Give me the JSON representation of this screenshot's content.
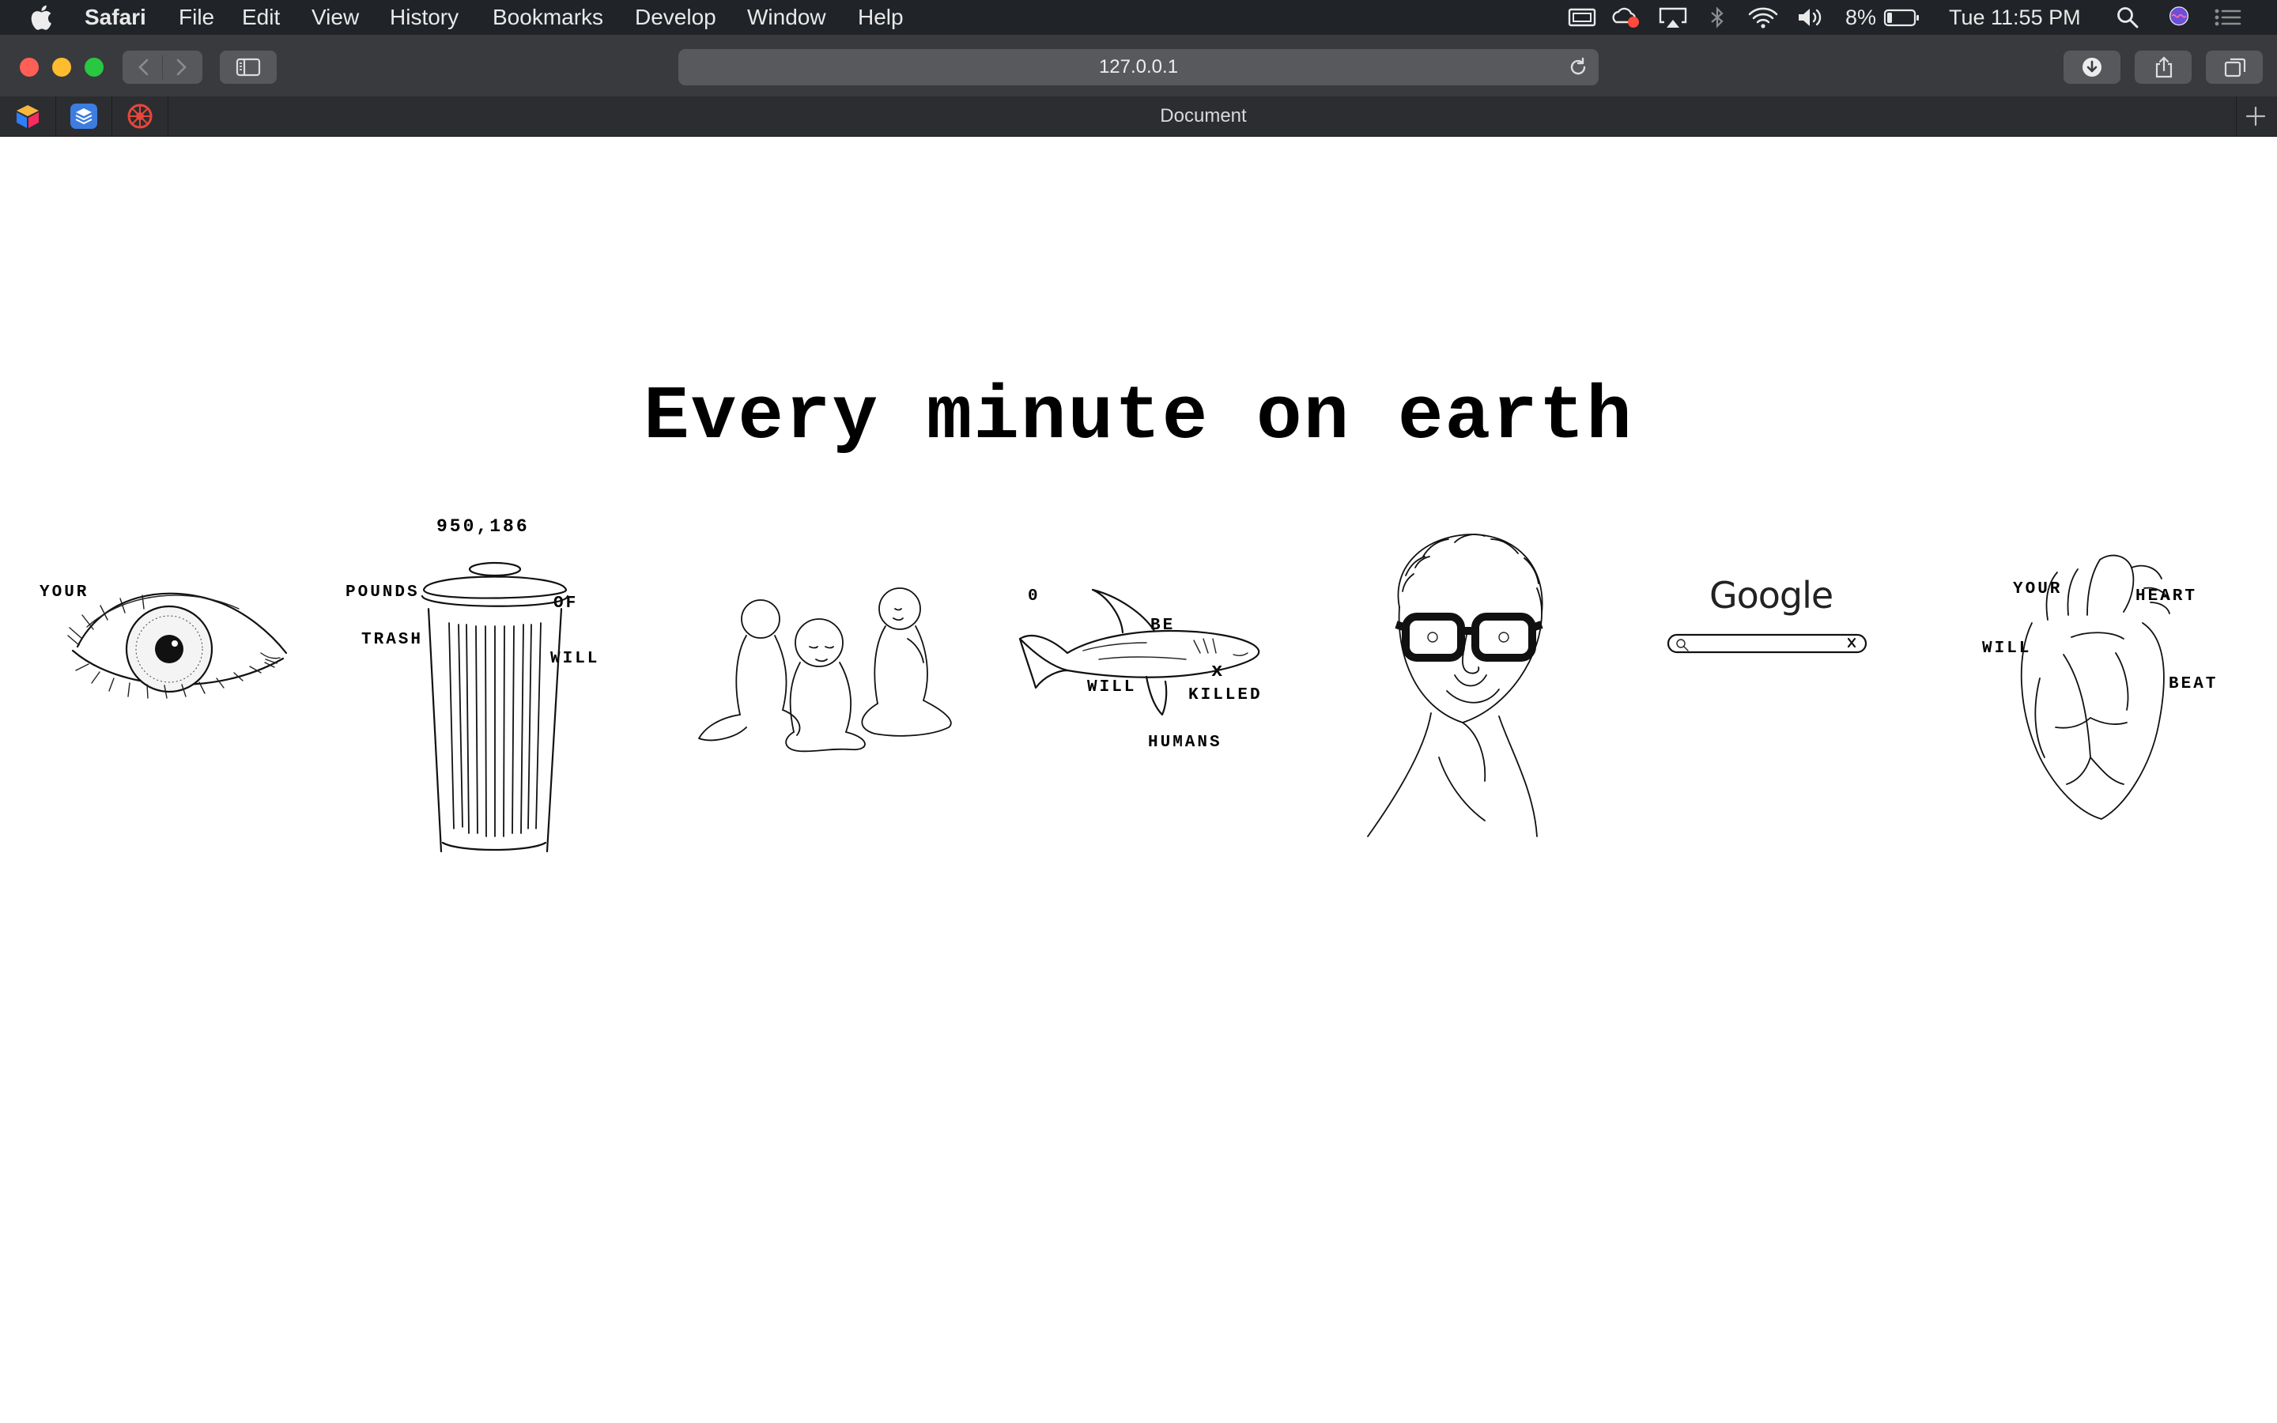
{
  "menubar": {
    "app": "Safari",
    "items": [
      "File",
      "Edit",
      "View",
      "History",
      "Bookmarks",
      "Develop",
      "Window",
      "Help"
    ],
    "battery_percent": "8%",
    "clock": "Tue 11:55 PM"
  },
  "toolbar": {
    "url": "127.0.0.1"
  },
  "tabbar": {
    "tab_title": "Document",
    "pinned": [
      "pinned-site-1",
      "pinned-site-2",
      "pinned-site-3"
    ]
  },
  "page": {
    "headline": "Every minute on earth",
    "eye": {
      "words": [
        "YOUR"
      ]
    },
    "trash": {
      "count": "950,186",
      "words": [
        "POUNDS",
        "OF",
        "TRASH",
        "WILL"
      ]
    },
    "shark": {
      "count": "0",
      "words": [
        "BE",
        "WILL",
        "KILLED",
        "HUMANS"
      ],
      "mark": "x"
    },
    "google": {
      "logo": "Google"
    },
    "heart": {
      "words": [
        "YOUR",
        "HEART",
        "WILL",
        "BEAT"
      ]
    }
  },
  "colors": {
    "menubar_bg": "#202327",
    "toolbar_bg": "#393a3d",
    "tabbar_bg": "#2c2d30",
    "close": "#ff5f57",
    "minimize": "#febc2e",
    "zoom": "#28c840"
  }
}
